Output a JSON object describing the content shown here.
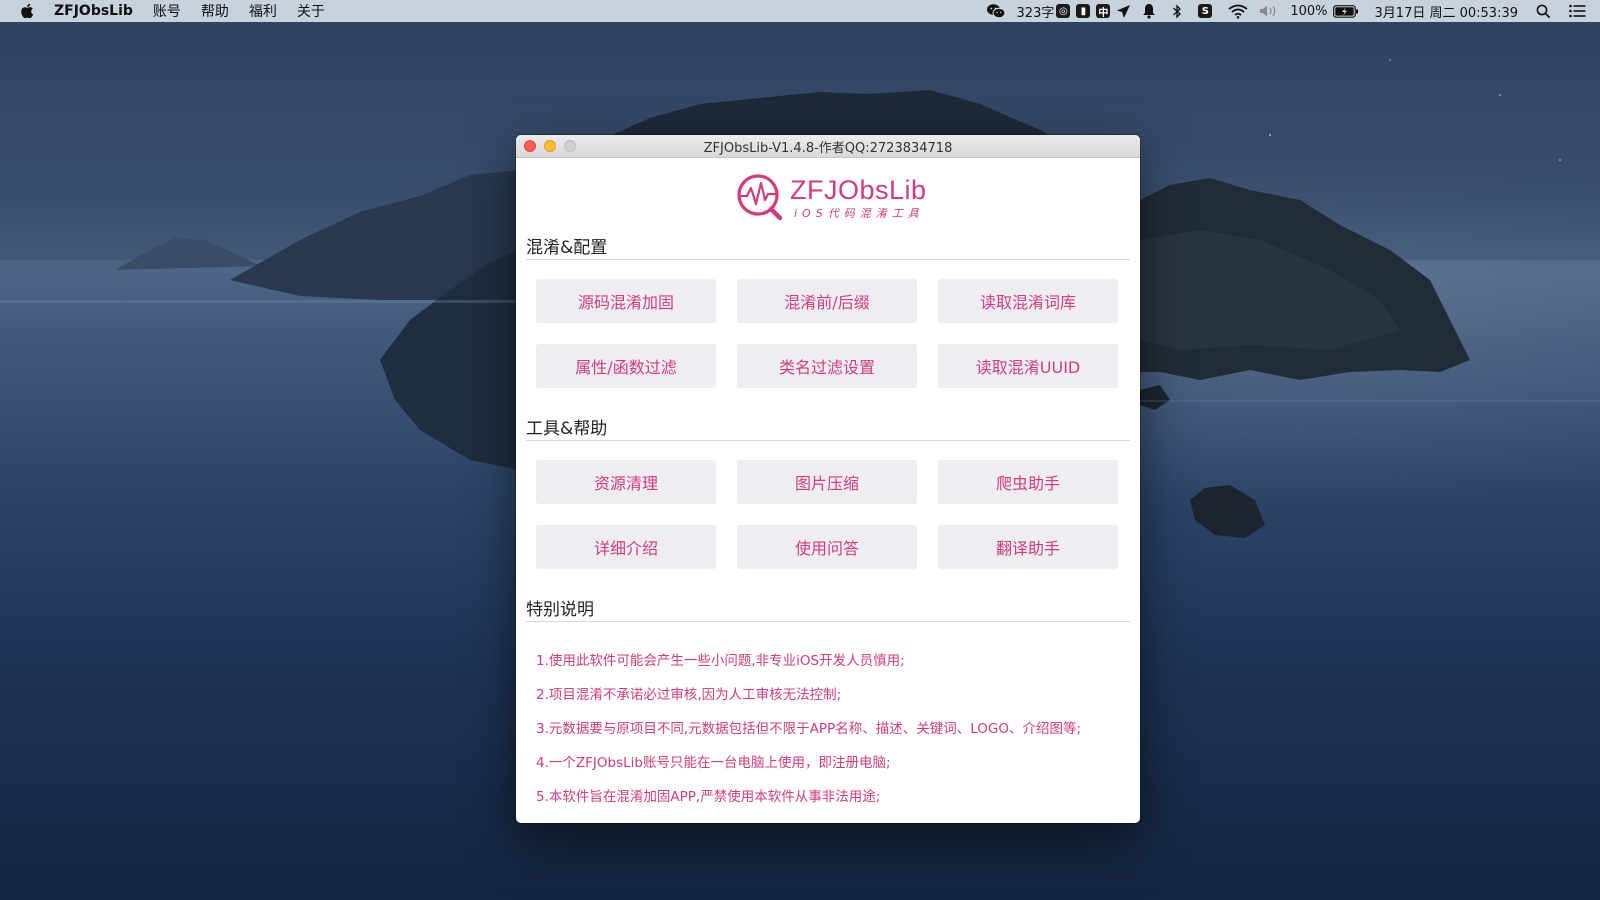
{
  "menubar": {
    "app_name": "ZFJObsLib",
    "items": [
      "账号",
      "帮助",
      "福利",
      "关于"
    ],
    "input_count": "323字",
    "battery": "100%",
    "datetime": "3月17日 周二  00:53:39"
  },
  "window": {
    "title": "ZFJObsLib-V1.4.8-作者QQ:2723834718",
    "logo": {
      "name": "ZFJObsLib",
      "tagline": "iOS代码混淆工具"
    },
    "sections": {
      "config": {
        "title": "混淆&配置",
        "buttons": [
          "源码混淆加固",
          "混淆前/后缀",
          "读取混淆词库",
          "属性/函数过滤",
          "类名过滤设置",
          "读取混淆UUID"
        ]
      },
      "tools": {
        "title": "工具&帮助",
        "buttons": [
          "资源清理",
          "图片压缩",
          "爬虫助手",
          "详细介绍",
          "使用问答",
          "翻译助手"
        ]
      },
      "notes": {
        "title": "特别说明",
        "items": [
          "1.使用此软件可能会产生一些小问题,非专业iOS开发人员慎用;",
          "2.项目混淆不承诺必过审核,因为人工审核无法控制;",
          "3.元数据要与原项目不同,元数据包括但不限于APP名称、描述、关键词、LOGO、介绍图等;",
          "4.一个ZFJObsLib账号只能在一台电脑上使用，即注册电脑;",
          "5.本软件旨在混淆加固APP,严禁使用本软件从事非法用途;"
        ]
      }
    }
  },
  "colors": {
    "accent": "#d23c7e",
    "button_bg": "#eeeef2"
  }
}
